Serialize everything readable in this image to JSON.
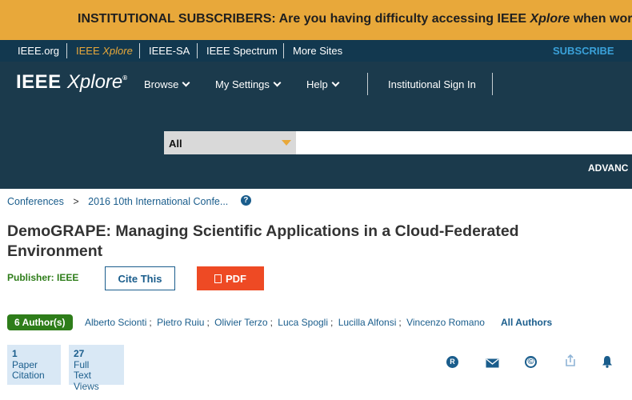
{
  "banner": {
    "text": "INSTITUTIONAL SUBSCRIBERS: Are you having difficulty accessing IEEE",
    "italic_word": "Xplore",
    "text_tail": "when working r"
  },
  "topnav": {
    "links": [
      "IEEE.org",
      "IEEE",
      "Xplore",
      "IEEE-SA",
      "IEEE Spectrum",
      "More Sites"
    ],
    "subscribe": "SUBSCRIBE"
  },
  "header": {
    "logo_ieee": "IEEE",
    "logo_xplore": "Xplore",
    "logo_mark": "®",
    "menu": [
      "Browse",
      "My Settings",
      "Help"
    ],
    "sign_in": "Institutional Sign In",
    "search_scope": "All",
    "search_value": "",
    "advanced": "ADVANC"
  },
  "breadcrumb": {
    "item1": "Conferences",
    "separator": ">",
    "item2": "2016 10th International Confe...",
    "help": "?"
  },
  "article": {
    "title": "DemoGRAPE: Managing Scientific Applications in a Cloud-Federated Environment",
    "publisher": "Publisher: IEEE",
    "cite_label": "Cite This",
    "pdf_label": "PDF"
  },
  "authors": {
    "badge": "6 Author(s)",
    "names": [
      "Alberto Scionti",
      "Pietro Ruiu",
      "Olivier Terzo",
      "Luca Spogli",
      "Lucilla Alfonsi",
      "Vincenzo Romano"
    ],
    "separator": ";",
    "all_label": "All Authors"
  },
  "metrics": [
    {
      "count": "1",
      "lines": [
        "Paper",
        "Citation"
      ]
    },
    {
      "count": "27",
      "lines": [
        "Full",
        "Text",
        "Views"
      ]
    }
  ],
  "actions": {
    "rights_letter": "R",
    "copyright_letter": "©"
  },
  "colors": {
    "banner": "#e8a83a",
    "topbar": "#12384f",
    "header": "#1b3a4c",
    "link": "#1a5d8c",
    "publisher_green": "#2e7d1a",
    "pdf_red": "#ee4a24",
    "metric_bg": "#d9e8f5"
  }
}
